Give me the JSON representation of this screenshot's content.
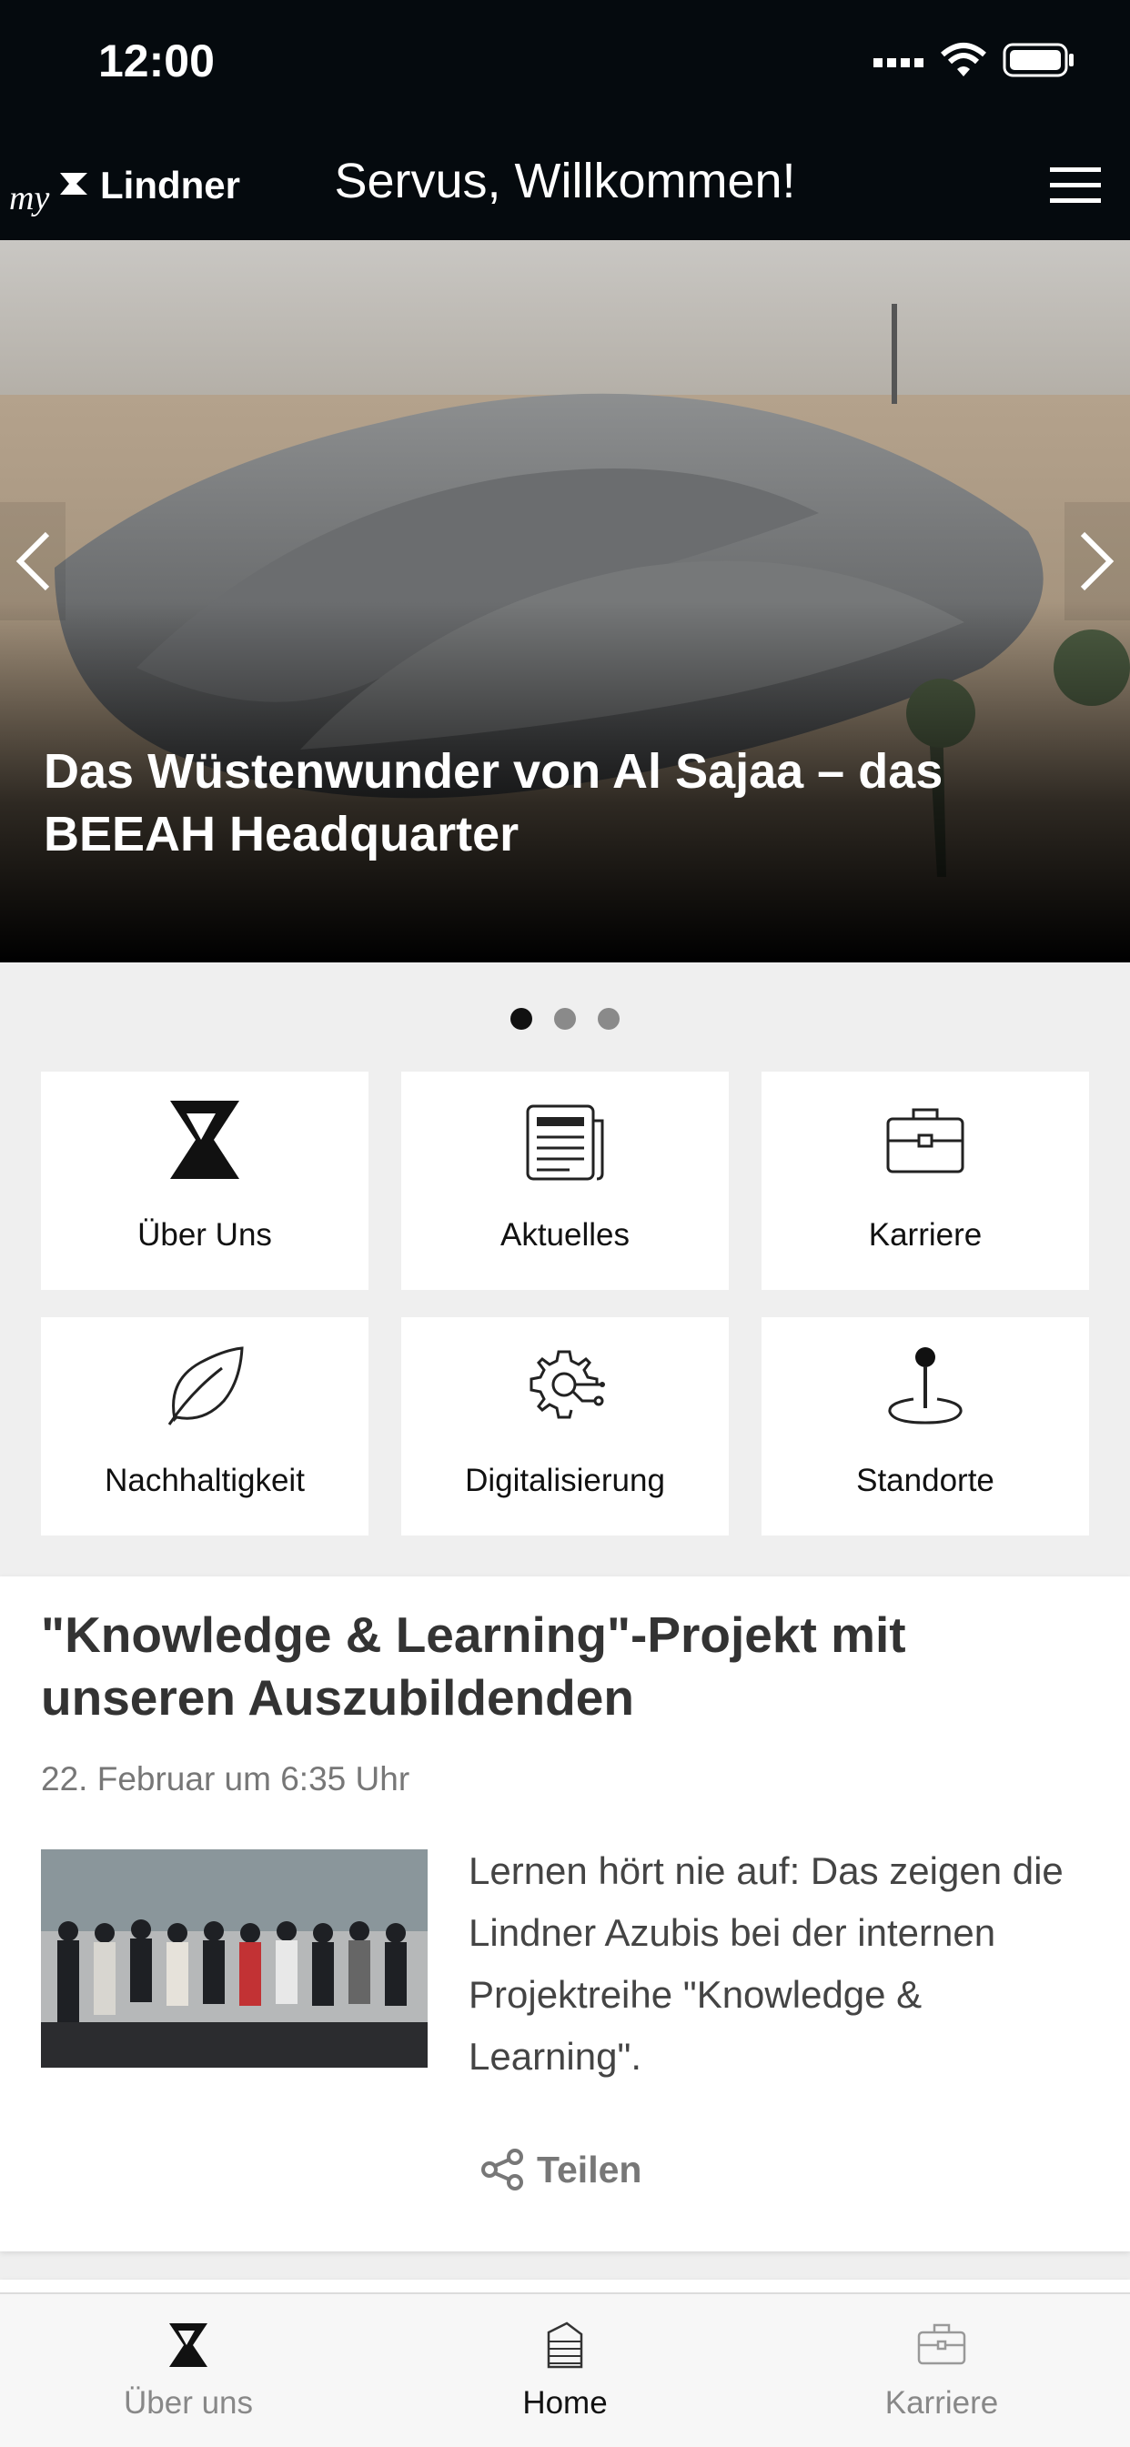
{
  "status_bar": {
    "time": "12:00",
    "icons": [
      "signal-icon",
      "wifi-icon",
      "battery-icon"
    ]
  },
  "header": {
    "logo_prefix": "my",
    "logo_text": "Lindner",
    "title": "Servus, Willkommen!"
  },
  "hero": {
    "caption": "Das Wüstenwunder von Al Sajaa – das BEEAH Headquarter",
    "slide_count": 3,
    "active_slide": 1
  },
  "tiles": [
    {
      "label": "Über Uns",
      "icon": "lindner-logo-icon"
    },
    {
      "label": "Aktuelles",
      "icon": "newspaper-icon"
    },
    {
      "label": "Karriere",
      "icon": "briefcase-icon"
    },
    {
      "label": "Nachhaltigkeit",
      "icon": "leaf-icon"
    },
    {
      "label": "Digitalisierung",
      "icon": "gear-circuit-icon"
    },
    {
      "label": "Standorte",
      "icon": "location-pin-icon"
    }
  ],
  "article": {
    "title": "\"Knowledge & Learning\"-Projekt mit unseren Auszubildenden",
    "date": "22. Februar um 6:35 Uhr",
    "excerpt": "Lernen hört nie auf: Das zeigen die Lindner Azubis bei der internen Projektreihe \"Knowledge & Learning\".",
    "share_label": "Teilen"
  },
  "tabbar": [
    {
      "label": "Über uns",
      "icon": "lindner-logo-icon",
      "active": false
    },
    {
      "label": "Home",
      "icon": "building-icon",
      "active": true
    },
    {
      "label": "Karriere",
      "icon": "briefcase-icon",
      "active": false
    }
  ],
  "colors": {
    "header_bg": "#050a0e",
    "page_bg": "#efefef",
    "active_dot": "#111111",
    "inactive_dot": "#8a8a8a"
  }
}
